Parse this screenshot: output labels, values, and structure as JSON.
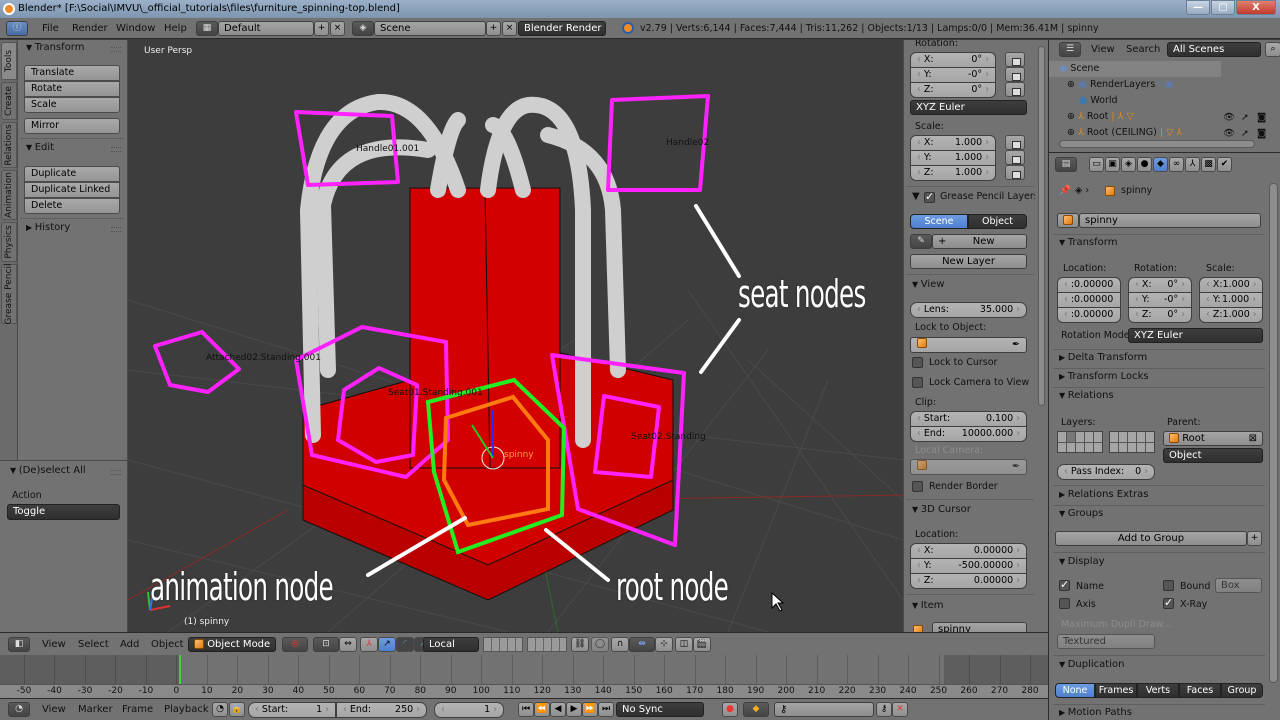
{
  "window": {
    "title": "Blender* [F:\\Social\\IMVU\\_official_tutorials\\files\\furniture_spinning-top.blend]",
    "buttons": [
      "—",
      "▢",
      "X"
    ]
  },
  "info_header": {
    "menus": [
      "File",
      "Render",
      "Window",
      "Help"
    ],
    "screen_layout": "Default",
    "scene": "Scene",
    "render_engine": "Blender Render",
    "stats": "v2.79 | Verts:6,144 | Faces:7,444 | Tris:11,262 | Objects:1/13 | Lamps:0/0 | Mem:36.41M | spinny"
  },
  "tool_tabs": [
    "Tools",
    "Create",
    "Relations",
    "Animation",
    "Physics",
    "Grease Pencil"
  ],
  "tool_shelf": {
    "transform": {
      "title": "Transform",
      "buttons": [
        "Translate",
        "Rotate",
        "Scale"
      ],
      "mirror": "Mirror"
    },
    "edit": {
      "title": "Edit",
      "buttons": [
        "Duplicate",
        "Duplicate Linked",
        "Delete"
      ]
    },
    "history": {
      "title": "History"
    }
  },
  "operator_panel": {
    "title": "(De)select All",
    "action_label": "Action",
    "action_value": "Toggle"
  },
  "viewport": {
    "view_name": "User Persp",
    "object_info": "(1) spinny",
    "object_labels": [
      "Handle01.001",
      "Handle02",
      "Attached02.Standing.001",
      "Seat01.Standing.001",
      "Seat02.Standing",
      "spinny"
    ],
    "annotations": {
      "seat": "seat nodes",
      "animation": "animation node",
      "root": "root node"
    },
    "colors": {
      "seat_outline": "#ff22ff",
      "root_outline": "#22ee22",
      "animation_outline": "#ff7a10",
      "mesh_red": "#d40000",
      "handle": "#d8d8d8"
    }
  },
  "n_panel": {
    "rotation_label": "Rotation:",
    "rotation": [
      {
        "axis": "X:",
        "value": "0°"
      },
      {
        "axis": "Y:",
        "value": "-0°"
      },
      {
        "axis": "Z:",
        "value": "0°"
      }
    ],
    "rotation_mode": "XYZ Euler",
    "scale_label": "Scale:",
    "scale": [
      {
        "axis": "X:",
        "value": "1.000"
      },
      {
        "axis": "Y:",
        "value": "1.000"
      },
      {
        "axis": "Z:",
        "value": "1.000"
      }
    ],
    "grease_pencil": {
      "title": "Grease Pencil Layers",
      "tab_scene": "Scene",
      "tab_object": "Object",
      "new": "New",
      "new_layer": "New Layer"
    },
    "view": {
      "title": "View",
      "lens_label": "Lens:",
      "lens_value": "35.000",
      "lock_to_object": "Lock to Object:",
      "lock_to_cursor": "Lock to Cursor",
      "lock_camera": "Lock Camera to View",
      "clip_label": "Clip:",
      "clip_start_label": "Start:",
      "clip_start": "0.100",
      "clip_end_label": "End:",
      "clip_end": "10000.000",
      "local_camera": "Local Camera:",
      "render_border": "Render Border"
    },
    "cursor": {
      "title": "3D Cursor",
      "location_label": "Location:",
      "x": "0.00000",
      "y": "-500.00000",
      "z": "0.00000"
    },
    "item": {
      "title": "Item",
      "name": "spinny"
    }
  },
  "outliner": {
    "menus": [
      "View",
      "Search"
    ],
    "filter": "All Scenes",
    "items": [
      {
        "label": "Scene"
      },
      {
        "label": "RenderLayers"
      },
      {
        "label": "World"
      },
      {
        "label": "Root"
      },
      {
        "label": "Root (CEILING)"
      }
    ]
  },
  "properties": {
    "breadcrumb": "spinny",
    "object_name": "spinny",
    "transform": {
      "title": "Transform",
      "location_label": "Location:",
      "rotation_label": "Rotation:",
      "scale_label": "Scale:",
      "location": [
        ":0.00000",
        ":0.00000",
        ":0.00000"
      ],
      "rotation": [
        {
          "axis": "X:",
          "value": "0°"
        },
        {
          "axis": "Y:",
          "value": "-0°"
        },
        {
          "axis": "Z:",
          "value": "0°"
        }
      ],
      "scale": [
        {
          "axis": "X:",
          "value": "1.000"
        },
        {
          "axis": "Y:",
          "value": "1.000"
        },
        {
          "axis": "Z:",
          "value": "1.000"
        }
      ],
      "rotation_mode_label": "Rotation Mode:",
      "rotation_mode": "XYZ Euler"
    },
    "delta_transform": "Delta Transform",
    "transform_locks": "Transform Locks",
    "relations": {
      "title": "Relations",
      "layers_label": "Layers:",
      "parent_label": "Parent:",
      "parent": "Root",
      "parent_type": "Object",
      "pass_index_label": "Pass Index:",
      "pass_index": "0"
    },
    "relations_extras": "Relations Extras",
    "groups": {
      "title": "Groups",
      "add": "Add to Group"
    },
    "display": {
      "title": "Display",
      "name": "Name",
      "name_checked": true,
      "axis": "Axis",
      "axis_checked": false,
      "bound": "Bound",
      "bound_checked": false,
      "bound_type": "Box",
      "xray": "X-Ray",
      "xray_checked": true,
      "max_dupli": "Maximum Dupli Draw...",
      "max_dupli_value": "Textured"
    },
    "duplication": {
      "title": "Duplication",
      "options": [
        "None",
        "Frames",
        "Verts",
        "Faces",
        "Group"
      ],
      "selected": "None"
    },
    "motion_paths": "Motion Paths"
  },
  "viewport_header": {
    "menus": [
      "View",
      "Select",
      "Add",
      "Object"
    ],
    "mode": "Object Mode",
    "orientation": "Local"
  },
  "timeline": {
    "ticks": [
      "-50",
      "-40",
      "-30",
      "-20",
      "-10",
      "0",
      "10",
      "20",
      "30",
      "40",
      "50",
      "60",
      "70",
      "80",
      "90",
      "100",
      "110",
      "120",
      "130",
      "140",
      "150",
      "160",
      "170",
      "180",
      "190",
      "200",
      "210",
      "220",
      "230",
      "240",
      "250",
      "260",
      "270",
      "280"
    ],
    "current_frame": "1",
    "menus": [
      "View",
      "Marker",
      "Frame",
      "Playback"
    ],
    "start_label": "Start:",
    "start": "1",
    "end_label": "End:",
    "end": "250",
    "sync": "No Sync"
  }
}
